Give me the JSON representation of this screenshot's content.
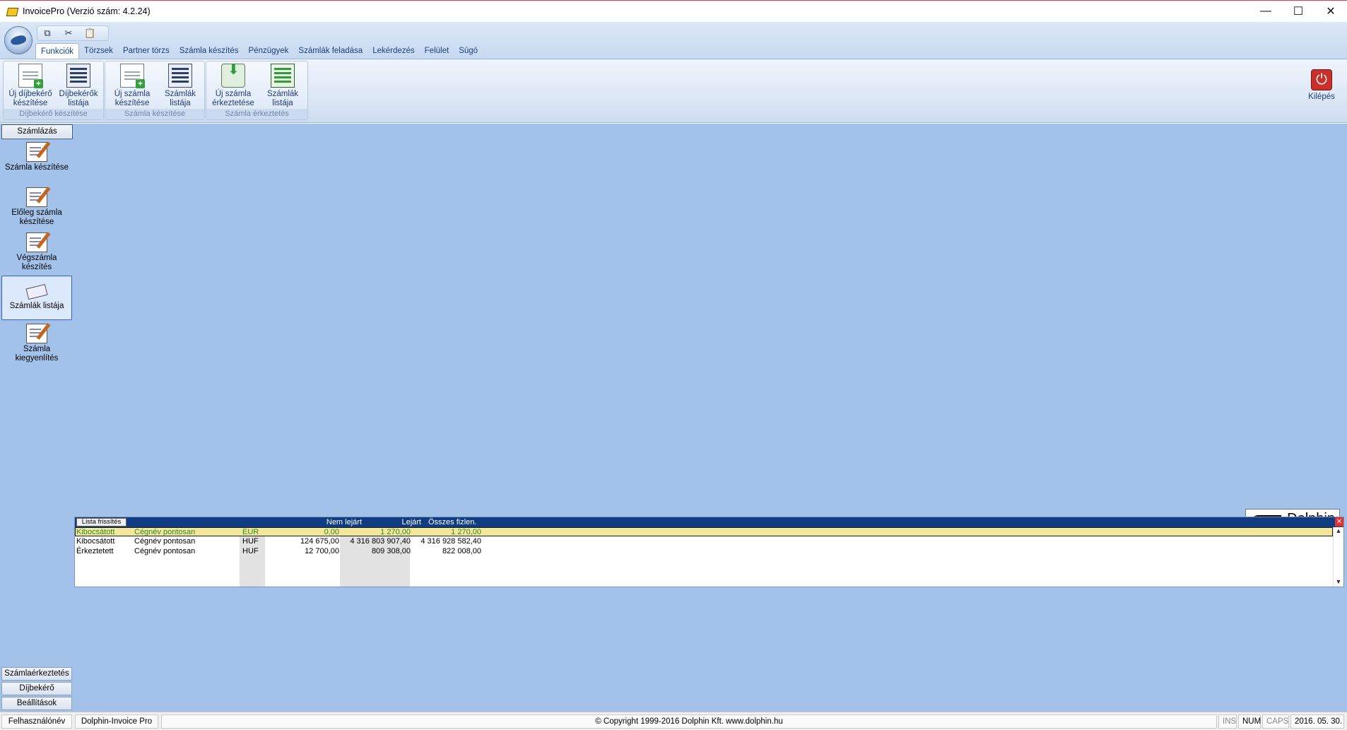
{
  "window": {
    "title": "InvoicePro  (Verzió szám: 4.2.24)",
    "controls": {
      "minimize": "—",
      "maximize": "☐",
      "close": "✕"
    }
  },
  "qat": {
    "copy_icon": "⧉",
    "cut_icon": "✂",
    "paste_icon": "📋"
  },
  "tabs": [
    "Funkciók",
    "Törzsek",
    "Partner törzs",
    "Számla készítés",
    "Pénzügyek",
    "Számlák feladása",
    "Lekérdezés",
    "Felület",
    "Súgó"
  ],
  "ribbon": {
    "groups": [
      {
        "label": "Díjbekérő készítése",
        "buttons": [
          {
            "label1": "Új díjbekérő",
            "label2": "készítése"
          },
          {
            "label1": "Díjbekérők",
            "label2": "listája"
          }
        ]
      },
      {
        "label": "Számla készítése",
        "buttons": [
          {
            "label1": "Új számla",
            "label2": "készítése"
          },
          {
            "label1": "Számlák",
            "label2": "listája"
          }
        ]
      },
      {
        "label": "Számla érkeztetés",
        "buttons": [
          {
            "label1": "Új számla",
            "label2": "érkeztetése"
          },
          {
            "label1": "Számlák",
            "label2": "listája"
          }
        ]
      }
    ],
    "logout_label": "Kilépés"
  },
  "sidebar": {
    "header": "Számlázás",
    "items": [
      {
        "label1": "Számla készítése",
        "label2": ""
      },
      {
        "label1": "Előleg számla",
        "label2": "készítése"
      },
      {
        "label1": "Végszámla készítés",
        "label2": ""
      },
      {
        "label1": "Számlák listája",
        "label2": ""
      },
      {
        "label1": "Számla kiegyenlítés",
        "label2": ""
      }
    ],
    "bottom": [
      "Számlaérkeztetés",
      "Díjbekérő",
      "Beállítások"
    ]
  },
  "logo_text": "Dolphin",
  "grid": {
    "refresh_label": "Lista frissítés",
    "headers": {
      "not_due": "Nem lejárt",
      "due": "Lejárt",
      "total": "Összes fizlen."
    },
    "rows": [
      {
        "type": "Kibocsátott",
        "name": "Cégnév pontosan",
        "currency": "EUR",
        "not_due": "0,00",
        "due": "1 270,00",
        "total": "1 270,00"
      },
      {
        "type": "Kibocsátott",
        "name": "Cégnév pontosan",
        "currency": "HUF",
        "not_due": "124 675,00",
        "due": "4 316 803 907,40",
        "total": "4 316 928 582,40"
      },
      {
        "type": "Érkeztetett",
        "name": "Cégnév pontosan",
        "currency": "HUF",
        "not_due": "12 700,00",
        "due": "809 308,00",
        "total": "822 008,00"
      }
    ]
  },
  "statusbar": {
    "user": "Felhasználónév",
    "product": "Dolphin-Invoice Pro",
    "copyright": "© Copyright 1999-2016 Dolphin Kft. www.dolphin.hu",
    "ins": "INS",
    "num": "NUM",
    "caps": "CAPS",
    "date": "2016. 05. 30."
  }
}
